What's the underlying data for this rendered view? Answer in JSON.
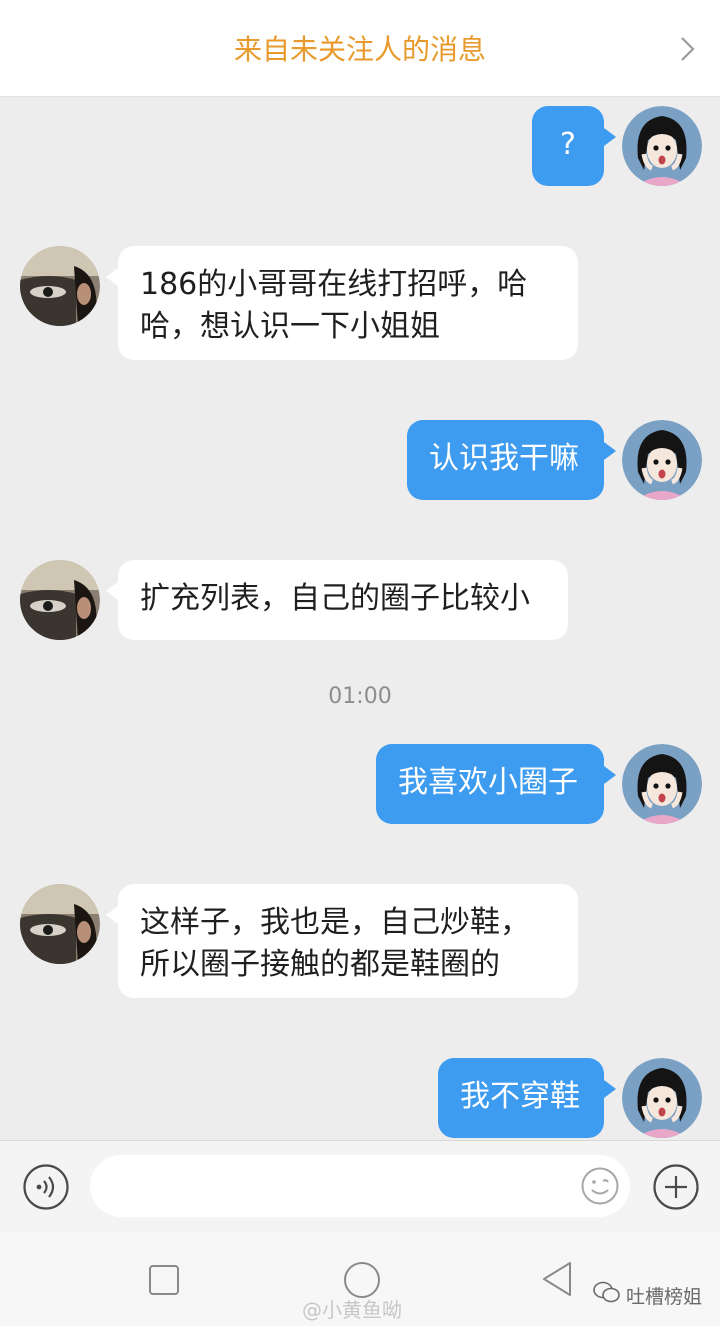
{
  "header": {
    "title": "来自未关注人的消息",
    "chevron_icon": "chevron-right-icon",
    "title_color": "#e89b2c"
  },
  "colors": {
    "outgoing_bubble": "#3d9bf0",
    "incoming_bubble": "#ffffff",
    "background": "#ededed"
  },
  "messages": [
    {
      "direction": "outgoing",
      "text": "?"
    },
    {
      "direction": "incoming",
      "lines": [
        "186的小哥哥在线打招呼，哈",
        "哈，想认识一下小姐姐"
      ]
    },
    {
      "direction": "outgoing",
      "text": "认识我干嘛"
    },
    {
      "direction": "incoming",
      "text": "扩充列表，自己的圈子比较小"
    },
    {
      "direction": "outgoing",
      "text": "我喜欢小圈子"
    },
    {
      "direction": "incoming",
      "lines": [
        "这样子，我也是，自己炒鞋，",
        "所以圈子接触的都是鞋圈的"
      ]
    },
    {
      "direction": "outgoing",
      "text": "我不穿鞋"
    }
  ],
  "timestamp": "01:00",
  "input_bar": {
    "voice_icon": "voice-icon",
    "input_value": "",
    "emoji_icon": "emoji-icon",
    "plus_icon": "plus-icon"
  },
  "nav_bar": {
    "recent_icon": "square-icon",
    "home_icon": "circle-icon",
    "back_icon": "triangle-back-icon"
  },
  "watermarks": {
    "weibo": "@小黄鱼呦",
    "wechat": "吐槽榜姐"
  }
}
